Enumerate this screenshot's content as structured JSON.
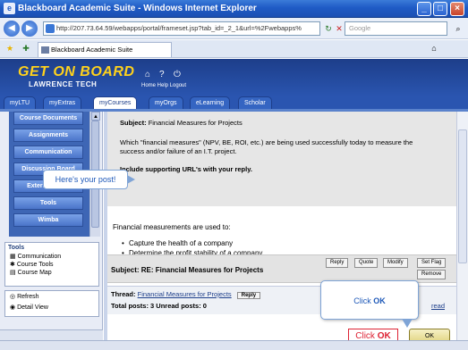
{
  "window": {
    "title": "Blackboard Academic Suite - Windows Internet Explorer",
    "controls": {
      "minimize": "_",
      "maximize": "□",
      "close": "×"
    }
  },
  "address": {
    "url": "http://207.73.64.59/webapps/portal/frameset.jsp?tab_id=_2_1&url=%2Fwebapps%",
    "search_placeholder": "Google"
  },
  "browser_tab": {
    "label": "Blackboard Academic Suite"
  },
  "header": {
    "logo_line1": "GET ON BOARD",
    "logo_line2": "LAWRENCE TECH",
    "links": "Home  Help  Logout"
  },
  "course_tabs": [
    {
      "label": "myLTU"
    },
    {
      "label": "myExtras"
    },
    {
      "label": "myCourses",
      "active": true
    },
    {
      "label": "myOrgs"
    },
    {
      "label": "eLearning"
    },
    {
      "label": "Scholar"
    }
  ],
  "sidebar": {
    "menu": [
      {
        "label": "Course Documents"
      },
      {
        "label": "Assignments"
      },
      {
        "label": "Communication"
      },
      {
        "label": "Discussion Board"
      },
      {
        "label": "External Links"
      },
      {
        "label": "Tools"
      },
      {
        "label": "Wimba"
      }
    ],
    "tools_title": "Tools",
    "tools_items": [
      {
        "label": "Communication"
      },
      {
        "label": "Course Tools"
      },
      {
        "label": "Course Map"
      }
    ],
    "refresh_items": [
      {
        "label": "Refresh"
      },
      {
        "label": "Detail View"
      }
    ]
  },
  "post": {
    "subject_label": "Subject:",
    "subject_value": "Financial Measures for Projects",
    "question_line1": "Which \"financial measures\" (NPV, BE, ROI, etc.) are being used successfully today to measure the",
    "question_line2": "success and/or failure of an I.T. project.",
    "instruction": "Include supporting URL's with your reply.",
    "reply_intro": "Financial measurements are used to:",
    "bullets": [
      "Capture the health of a company",
      "Determine the profit stability of a company"
    ]
  },
  "reply_bar": {
    "subject": "Subject: RE: Financial Measures for Projects",
    "buttons": [
      "Reply",
      "Quote",
      "Modify",
      "Set Flag",
      "Remove"
    ]
  },
  "thread": {
    "label": "Thread:",
    "link": "Financial Measures for Projects",
    "reply_btn": "Reply",
    "stats": "Total posts: 3   Unread posts: 0",
    "read_link": "read"
  },
  "callouts": {
    "post": "Here's your post!",
    "click_ok_prefix": "Click ",
    "click_ok_bold": "OK"
  },
  "bottom_buttons": {
    "click_ok_prefix": "Click ",
    "click_ok_bold": "OK",
    "ok_button": "OK"
  }
}
